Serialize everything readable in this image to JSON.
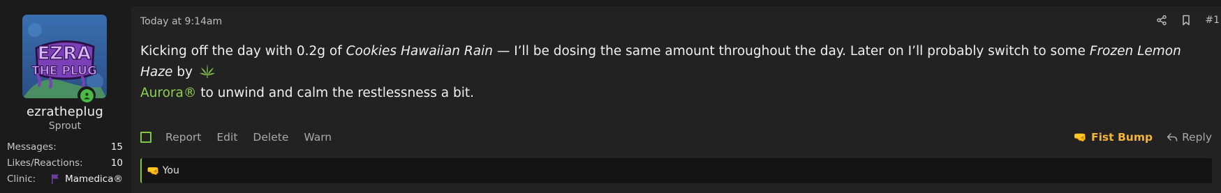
{
  "user": {
    "username": "ezratheplug",
    "title": "Sprout",
    "avatar_text_line1": "EZRA",
    "avatar_text_line2": "THE PLUG",
    "stats": [
      {
        "label": "Messages:",
        "value": "15"
      },
      {
        "label": "Likes/Reactions:",
        "value": "10"
      },
      {
        "label": "Clinic:",
        "value": "Mamedica®"
      }
    ]
  },
  "message": {
    "date": "Today at 9:14am",
    "post_number": "#1",
    "text": {
      "p1": "Kicking off the day with 0.2g of ",
      "strain1": "Cookies Hawaiian Rain",
      "p2": " — I’ll be dosing the same amount throughout the day. Later on I’ll probably switch to some ",
      "strain2": "Frozen Lemon Haze",
      "p3": " by ",
      "brand": "Aurora®",
      "p4": " to unwind and calm the restlessness a bit."
    }
  },
  "footer": {
    "report": "Report",
    "edit": "Edit",
    "delete": "Delete",
    "warn": "Warn",
    "fist_bump": "Fist Bump",
    "fist_emoji": "🤜",
    "reply": "Reply"
  },
  "reactions": {
    "emoji": "🤜",
    "text": "You"
  },
  "icons": {
    "share": "share-icon",
    "bookmark": "bookmark-icon",
    "leaf": "cannabis-leaf-icon",
    "flag": "flag-icon",
    "online": "online-status-icon",
    "reply": "reply-arrow-icon"
  },
  "colors": {
    "accent_green": "#7fc843",
    "brand_link": "#8fd14f",
    "fist_bump": "#f2b53a",
    "background": "#1b1b1b",
    "message_bg": "#222222"
  }
}
